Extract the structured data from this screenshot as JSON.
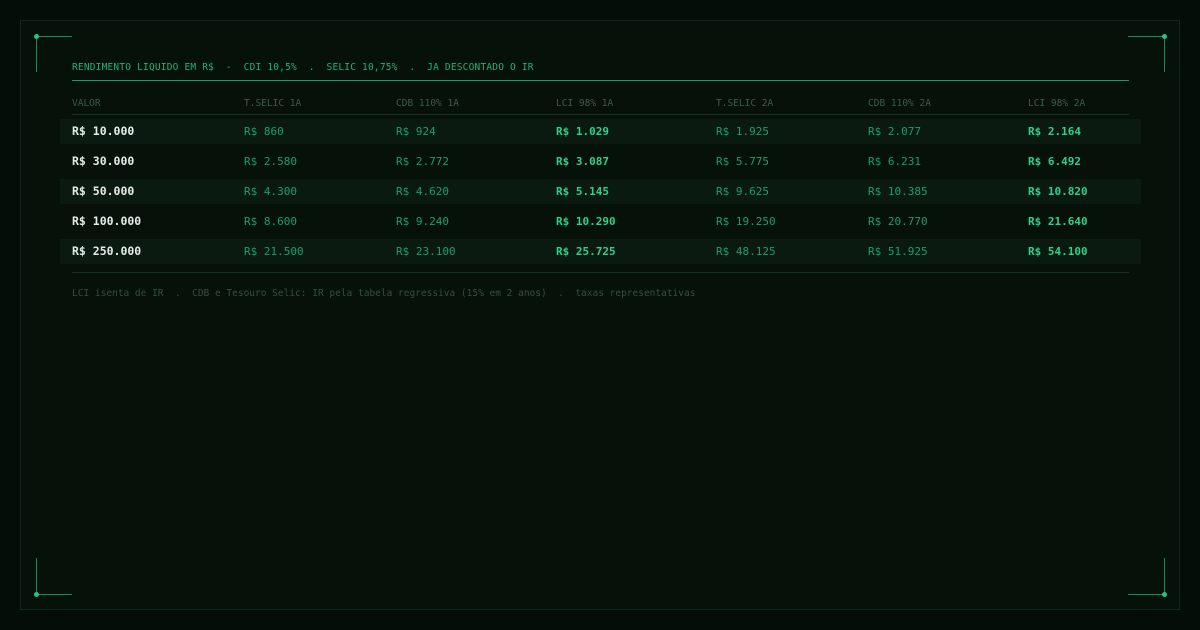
{
  "header": {
    "title": "RENDIMENTO LIQUIDO EM R$  -  CDI 10,5%  .  SELIC 10,75%  .  JA DESCONTADO O IR"
  },
  "table": {
    "columns": [
      "VALOR",
      "T.SELIC 1A",
      "CDB 110% 1A",
      "LCI 98% 1A",
      "T.SELIC 2A",
      "CDB 110% 2A",
      "LCI 98% 2A"
    ],
    "rows": [
      [
        "R$ 10.000",
        "R$ 860",
        "R$ 924",
        "R$ 1.029",
        "R$ 1.925",
        "R$ 2.077",
        "R$ 2.164"
      ],
      [
        "R$ 30.000",
        "R$ 2.580",
        "R$ 2.772",
        "R$ 3.087",
        "R$ 5.775",
        "R$ 6.231",
        "R$ 6.492"
      ],
      [
        "R$ 50.000",
        "R$ 4.300",
        "R$ 4.620",
        "R$ 5.145",
        "R$ 9.625",
        "R$ 10.385",
        "R$ 10.820"
      ],
      [
        "R$ 100.000",
        "R$ 8.600",
        "R$ 9.240",
        "R$ 10.290",
        "R$ 19.250",
        "R$ 20.770",
        "R$ 21.640"
      ],
      [
        "R$ 250.000",
        "R$ 21.500",
        "R$ 23.100",
        "R$ 25.725",
        "R$ 48.125",
        "R$ 51.925",
        "R$ 54.100"
      ]
    ]
  },
  "footnote": "LCI isenta de IR  .  CDB e Tesouro Selic: IR pela tabela regressiva (15% em 2 anos)  .  taxas representativas",
  "colors": {
    "background": "#061109",
    "accent": "#22c484",
    "value_text": "#e4ece7",
    "muted": "#3f5a4b"
  }
}
